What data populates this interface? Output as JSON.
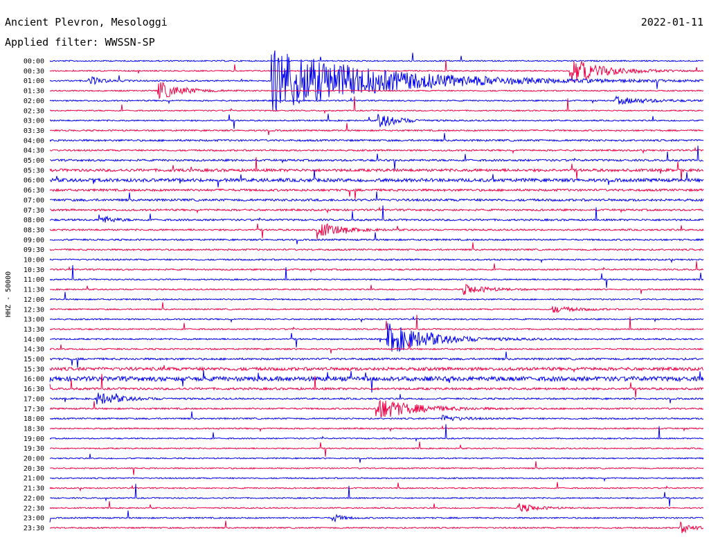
{
  "chart_data": {
    "type": "line",
    "title": "Ancient Plevron, Mesologgi",
    "subtitle": "Applied filter: WWSSN-SP",
    "date": "2022-01-11",
    "ylabel": "HHZ - 50000",
    "grid": false,
    "colors": [
      "#0000ee",
      "#ee0044"
    ],
    "trace_labels": [
      "00:00",
      "00:30",
      "01:00",
      "01:30",
      "02:00",
      "02:30",
      "03:00",
      "03:30",
      "04:00",
      "04:30",
      "05:00",
      "05:30",
      "06:00",
      "06:30",
      "07:00",
      "07:30",
      "08:00",
      "08:30",
      "09:00",
      "09:30",
      "10:00",
      "10:30",
      "11:00",
      "11:30",
      "12:00",
      "12:30",
      "13:00",
      "13:30",
      "14:00",
      "14:30",
      "15:00",
      "15:30",
      "16:00",
      "16:30",
      "17:00",
      "17:30",
      "18:00",
      "18:30",
      "19:00",
      "19:30",
      "20:00",
      "20:30",
      "21:00",
      "21:30",
      "22:00",
      "22:30",
      "23:00",
      "23:30"
    ],
    "noise_level": [
      1.0,
      1.0,
      1.1,
      1.0,
      1.1,
      1.0,
      1.1,
      1.2,
      1.5,
      1.3,
      1.6,
      2.2,
      2.6,
      1.8,
      1.8,
      1.5,
      1.5,
      1.3,
      1.3,
      1.3,
      1.2,
      1.2,
      1.1,
      1.1,
      1.1,
      1.1,
      1.1,
      1.1,
      1.2,
      1.2,
      1.6,
      2.5,
      3.6,
      1.8,
      1.3,
      1.3,
      1.2,
      1.1,
      1.0,
      1.0,
      1.0,
      1.0,
      1.0,
      1.0,
      1.0,
      1.0,
      1.1,
      1.1
    ],
    "events": [
      {
        "trace": "01:00",
        "minute": 10.2,
        "amplitude": 9.5,
        "duration": 4.5
      },
      {
        "trace": "01:00",
        "minute": 1.8,
        "amplitude": 1.3,
        "duration": 0.6
      },
      {
        "trace": "00:30",
        "minute": 23.9,
        "amplitude": 3.5,
        "duration": 1.5
      },
      {
        "trace": "01:30",
        "minute": 5.0,
        "amplitude": 2.6,
        "duration": 1.0
      },
      {
        "trace": "02:00",
        "minute": 26.0,
        "amplitude": 1.0,
        "duration": 1.5
      },
      {
        "trace": "03:00",
        "minute": 15.1,
        "amplitude": 2.2,
        "duration": 0.8
      },
      {
        "trace": "08:00",
        "minute": 2.3,
        "amplitude": 1.3,
        "duration": 0.5
      },
      {
        "trace": "08:30",
        "minute": 12.3,
        "amplitude": 2.4,
        "duration": 0.9
      },
      {
        "trace": "11:30",
        "minute": 19.0,
        "amplitude": 1.4,
        "duration": 1.0
      },
      {
        "trace": "12:30",
        "minute": 23.0,
        "amplitude": 1.0,
        "duration": 1.0
      },
      {
        "trace": "14:00",
        "minute": 15.5,
        "amplitude": 4.5,
        "duration": 1.8
      },
      {
        "trace": "17:00",
        "minute": 2.2,
        "amplitude": 1.8,
        "duration": 1.0
      },
      {
        "trace": "17:30",
        "minute": 15.0,
        "amplitude": 3.2,
        "duration": 1.6
      },
      {
        "trace": "18:00",
        "minute": 18.0,
        "amplitude": 0.9,
        "duration": 0.8
      },
      {
        "trace": "22:30",
        "minute": 21.5,
        "amplitude": 1.3,
        "duration": 0.8
      },
      {
        "trace": "23:00",
        "minute": 13.0,
        "amplitude": 1.2,
        "duration": 0.4
      },
      {
        "trace": "23:30",
        "minute": 29.0,
        "amplitude": 1.4,
        "duration": 0.6
      }
    ]
  }
}
